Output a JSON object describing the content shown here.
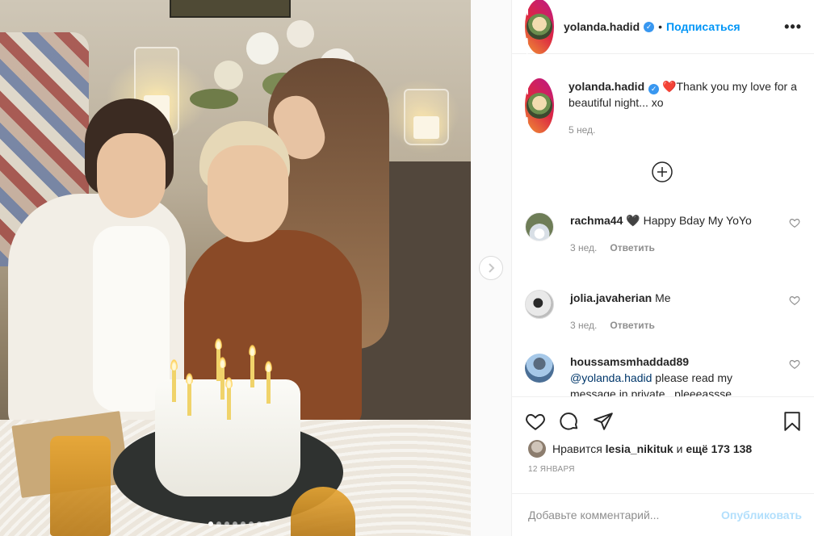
{
  "post": {
    "author": "yolanda.hadid",
    "follow_label": "Подписаться",
    "separator": "•",
    "more_label": "•••"
  },
  "caption": {
    "username": "yolanda.hadid",
    "emoji": "❤️",
    "text": "Thank you my love for a beautiful night... xo",
    "time": "5 нед."
  },
  "comments": [
    {
      "username": "rachma44",
      "text": "🖤 Happy Bday My YoYo",
      "time": "3 нед.",
      "reply_label": "Ответить"
    },
    {
      "username": "jolia.javaherian",
      "text": "Me",
      "time": "3 нед.",
      "reply_label": "Ответить"
    },
    {
      "username": "houssamsmhaddad89",
      "mention": "@yolanda.hadid",
      "text": " please read my message in private...pleeeassse",
      "time": "",
      "reply_label": ""
    }
  ],
  "likes": {
    "prefix": "Нравится",
    "user": "lesia_nikituk",
    "middle": "и",
    "others": "ещё 173 138"
  },
  "date": "12 января",
  "add_comment": {
    "placeholder": "Добавьте комментарий...",
    "publish_label": "Опубликовать"
  },
  "carousel": {
    "slide_count": 8,
    "active_index": 0
  },
  "colors": {
    "link_blue": "#0095f6",
    "verified_blue": "#3897f0",
    "publish_disabled": "#b2dffc",
    "muted": "#8e8e8e"
  },
  "icons": [
    "verified-icon",
    "more-icon",
    "add-comments-icon",
    "heart-icon",
    "comment-icon",
    "share-icon",
    "bookmark-icon",
    "chevron-right-icon"
  ]
}
